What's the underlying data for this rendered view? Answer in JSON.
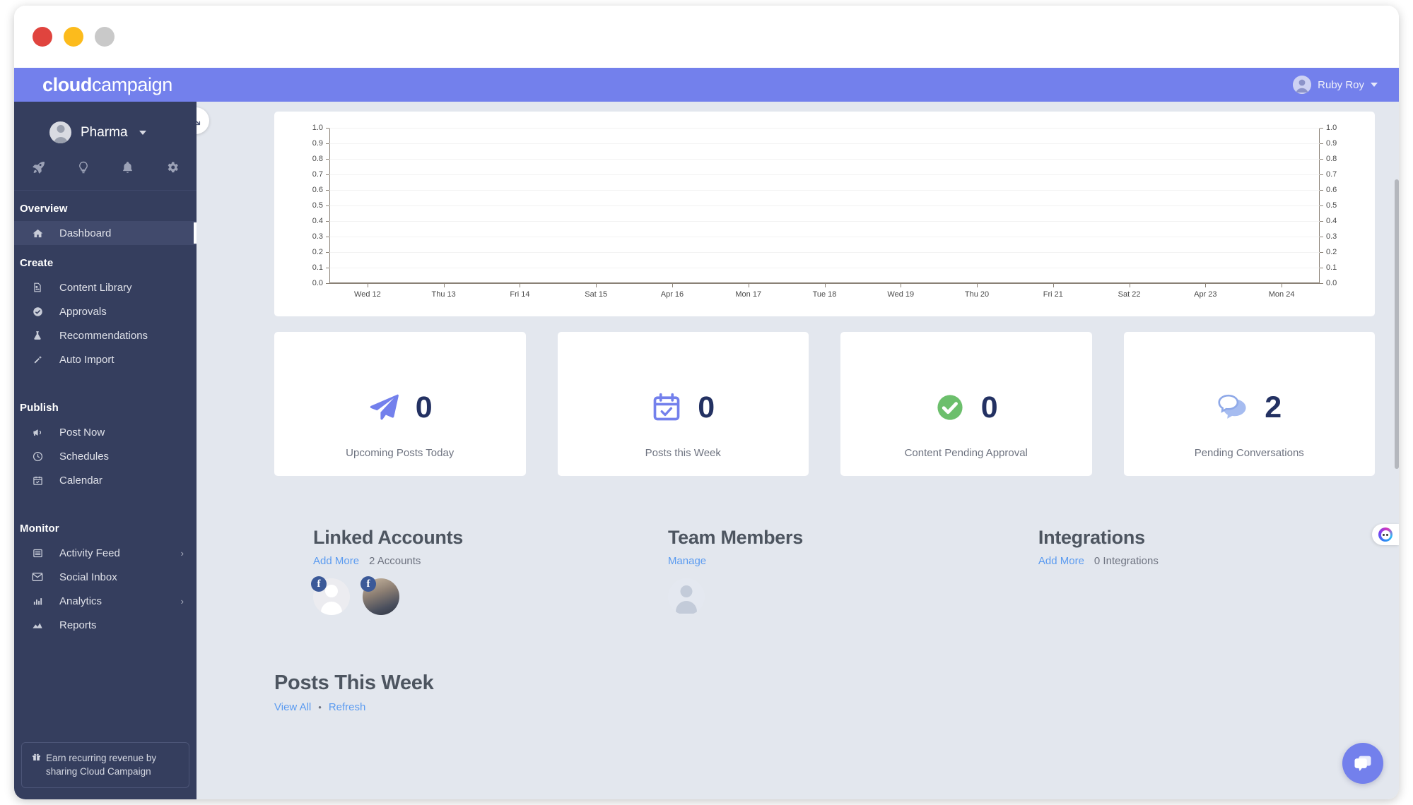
{
  "window": {
    "traffic_lights": [
      "close",
      "minimize",
      "maximize"
    ]
  },
  "topbar": {
    "brand_bold": "cloud",
    "brand_light": "campaign",
    "user_name": "Ruby Roy"
  },
  "sidebar": {
    "workspace_name": "Pharma",
    "quick_icons": [
      "rocket-icon",
      "lightbulb-icon",
      "bell-icon",
      "gear-icon"
    ],
    "sections": [
      {
        "label": "Overview",
        "items": [
          {
            "label": "Dashboard",
            "icon": "home-icon",
            "active": true,
            "chevron": false
          }
        ]
      },
      {
        "label": "Create",
        "items": [
          {
            "label": "Content Library",
            "icon": "image-file-icon",
            "active": false,
            "chevron": false
          },
          {
            "label": "Approvals",
            "icon": "check-circle-icon",
            "active": false,
            "chevron": false
          },
          {
            "label": "Recommendations",
            "icon": "beaker-icon",
            "active": false,
            "chevron": false
          },
          {
            "label": "Auto Import",
            "icon": "magic-wand-icon",
            "active": false,
            "chevron": false
          }
        ]
      },
      {
        "label": "Publish",
        "items": [
          {
            "label": "Post Now",
            "icon": "megaphone-icon",
            "active": false,
            "chevron": false
          },
          {
            "label": "Schedules",
            "icon": "clock-icon",
            "active": false,
            "chevron": false
          },
          {
            "label": "Calendar",
            "icon": "calendar-icon",
            "active": false,
            "chevron": false
          }
        ]
      },
      {
        "label": "Monitor",
        "items": [
          {
            "label": "Activity Feed",
            "icon": "list-icon",
            "active": false,
            "chevron": true
          },
          {
            "label": "Social Inbox",
            "icon": "envelope-icon",
            "active": false,
            "chevron": false
          },
          {
            "label": "Analytics",
            "icon": "bar-chart-icon",
            "active": false,
            "chevron": true
          },
          {
            "label": "Reports",
            "icon": "area-chart-icon",
            "active": false,
            "chevron": false
          }
        ]
      }
    ],
    "promo": "Earn recurring revenue by sharing Cloud Campaign",
    "promo_icon": "gift-icon"
  },
  "main": {
    "expand_icon": "expand-diagonal-icon"
  },
  "chart_data": {
    "type": "line",
    "title": "",
    "xlabel": "",
    "ylabel": "",
    "grid": true,
    "legend": false,
    "ylim": [
      0.0,
      1.0
    ],
    "x": [
      "Wed 12",
      "Thu 13",
      "Fri 14",
      "Sat 15",
      "Apr 16",
      "Mon 17",
      "Tue 18",
      "Wed 19",
      "Thu 20",
      "Fri 21",
      "Sat 22",
      "Apr 23",
      "Mon 24"
    ],
    "y_ticks": [
      "0.0",
      "0.1",
      "0.2",
      "0.3",
      "0.4",
      "0.5",
      "0.6",
      "0.7",
      "0.8",
      "0.9",
      "1.0"
    ],
    "y_ticks_right": [
      "0.0",
      "0.1",
      "0.2",
      "0.3",
      "0.4",
      "0.5",
      "0.6",
      "0.7",
      "0.8",
      "0.9",
      "1.0"
    ],
    "series": [
      {
        "name": "",
        "values": []
      }
    ]
  },
  "stats": [
    {
      "value": "0",
      "label": "Upcoming Posts Today",
      "icon": "paper-plane-icon",
      "color": "#7380ec"
    },
    {
      "value": "0",
      "label": "Posts this Week",
      "icon": "calendar-check-icon",
      "color": "#7380ec"
    },
    {
      "value": "0",
      "label": "Content Pending Approval",
      "icon": "check-circle-filled-icon",
      "color": "#6cbf6c"
    },
    {
      "value": "2",
      "label": "Pending Conversations",
      "icon": "chat-bubbles-icon",
      "color": "#9db4ef"
    }
  ],
  "info": {
    "linked_accounts": {
      "title": "Linked Accounts",
      "action": "Add More",
      "count_text": "2 Accounts",
      "accounts": [
        {
          "network": "facebook",
          "avatar": "placeholder"
        },
        {
          "network": "facebook",
          "avatar": "photo"
        }
      ]
    },
    "team_members": {
      "title": "Team Members",
      "action": "Manage",
      "members": [
        {
          "avatar": "placeholder"
        }
      ]
    },
    "integrations": {
      "title": "Integrations",
      "action": "Add More",
      "count_text": "0 Integrations"
    }
  },
  "posts_section": {
    "title": "Posts This Week",
    "view_all": "View All",
    "separator": "•",
    "refresh": "Refresh"
  },
  "floating": {
    "chat_icon": "chat-bubbles-fab-icon",
    "bot_icon": "ai-bot-icon"
  },
  "colors": {
    "brand": "#7380ec",
    "sidebar": "#353e5e",
    "canvas": "#e3e7ee",
    "link": "#5b9bf0",
    "stat_number": "#233162",
    "green": "#6cbf6c"
  }
}
